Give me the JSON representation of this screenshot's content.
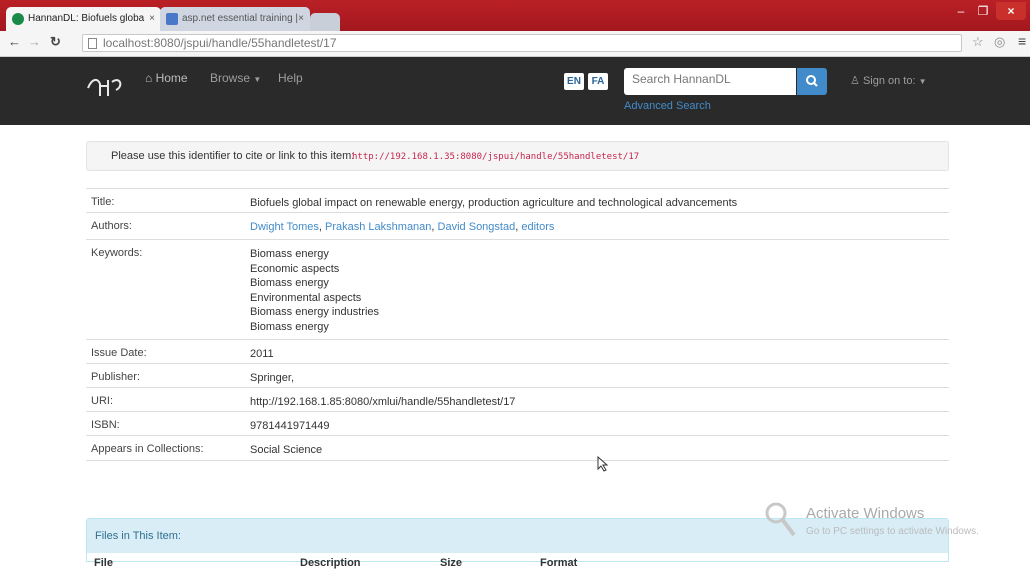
{
  "browser": {
    "tabs": [
      {
        "title": "HannanDL: Biofuels globa",
        "active": true,
        "icon_color": "#1a8a4a"
      },
      {
        "title": "asp.net essential training |",
        "active": false,
        "icon_color": "#4a78c8"
      }
    ],
    "tab_close": "×",
    "window_controls": {
      "minimize": "–",
      "maximize": "❐",
      "close": "×"
    },
    "url_host": "localhost",
    "url_path": ":8080/jspui/handle/55handletest/17",
    "icons": [
      "back-icon",
      "forward-icon",
      "reload-icon",
      "page-icon",
      "star-icon",
      "globe-icon",
      "menu-icon"
    ]
  },
  "nav": {
    "home": "Home",
    "browse": "Browse",
    "help": "Help",
    "lang_en": "EN",
    "lang_fa": "FA",
    "search_placeholder": "Search HannanDL",
    "advanced_search": "Advanced Search",
    "sign_on": "Sign on to:"
  },
  "cite": {
    "label": "Please use this identifier to cite or link to this item:",
    "url": "http://192.168.1.35:8080/jspui/handle/55handletest/17"
  },
  "metadata": {
    "title_label": "Title:",
    "title_value": "Biofuels global impact on renewable energy, production agriculture and technological advancements",
    "authors_label": "Authors:",
    "authors": [
      "Dwight Tomes",
      "Prakash Lakshmanan",
      "David Songstad",
      "editors"
    ],
    "keywords_label": "Keywords:",
    "keywords": [
      "Biomass energy",
      "Economic aspects",
      "Biomass energy",
      "Environmental aspects",
      "Biomass energy industries",
      "Biomass energy"
    ],
    "issue_label": "Issue Date:",
    "issue_value": "2011",
    "publisher_label": "Publisher:",
    "publisher_value": "Springer,",
    "uri_label": "URI:",
    "uri_value": "http://192.168.1.85:8080/xmlui/handle/55handletest/17",
    "isbn_label": "ISBN:",
    "isbn_value": "9781441971449",
    "collections_label": "Appears in Collections:",
    "collections_value": "Social Science"
  },
  "files": {
    "heading": "Files in This Item:",
    "columns": [
      "File",
      "Description",
      "Size",
      "Format"
    ]
  },
  "windows_watermark": {
    "title": "Activate Windows",
    "subtitle": "Go to PC settings to activate Windows."
  },
  "colors": {
    "navbar": "#2a2a2a",
    "link": "#428bca",
    "chrome_frame": "#ba2026"
  }
}
